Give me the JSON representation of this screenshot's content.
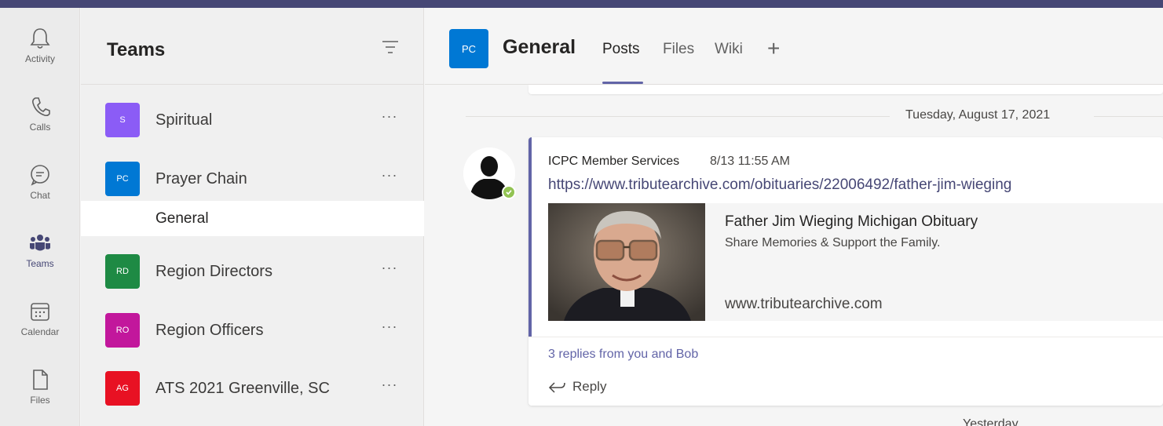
{
  "rail": {
    "items": [
      {
        "label": "Activity",
        "icon": "bell-icon"
      },
      {
        "label": "Calls",
        "icon": "phone-icon"
      },
      {
        "label": "Chat",
        "icon": "chat-icon"
      },
      {
        "label": "Teams",
        "icon": "teams-icon",
        "active": true
      },
      {
        "label": "Calendar",
        "icon": "calendar-icon"
      },
      {
        "label": "Files",
        "icon": "file-icon"
      }
    ]
  },
  "teams_panel": {
    "title": "Teams",
    "teams": [
      {
        "initials": "S",
        "name": "Spiritual",
        "color": "#8b5cf6"
      },
      {
        "initials": "PC",
        "name": "Prayer Chain",
        "color": "#0078d4"
      },
      {
        "initials": "RD",
        "name": "Region Directors",
        "color": "#1e8a44"
      },
      {
        "initials": "RO",
        "name": "Region Officers",
        "color": "#c2179c"
      },
      {
        "initials": "AG",
        "name": "ATS 2021 Greenville, SC",
        "color": "#e81123"
      }
    ],
    "selected_channel": "General"
  },
  "main": {
    "channel_initials": "PC",
    "channel_title": "General",
    "tabs": [
      {
        "label": "Posts",
        "active": true
      },
      {
        "label": "Files"
      },
      {
        "label": "Wiki"
      }
    ],
    "add_tab": "+",
    "date_divider": "Tuesday, August 17, 2021",
    "post": {
      "author": "ICPC Member Services",
      "time": "8/13 11:55 AM",
      "link": "https://www.tributearchive.com/obituaries/22006492/father-jim-wieging",
      "preview": {
        "title": "Father Jim Wieging Michigan Obituary",
        "description": "Share Memories & Support the Family.",
        "domain": "www.tributearchive.com"
      },
      "replies": "3 replies from you and Bob",
      "reply_label": "Reply"
    },
    "next_date": "Yesterday"
  },
  "colors": {
    "accent": "#6264a7",
    "topbar": "#464775",
    "presence": "#92c353"
  }
}
